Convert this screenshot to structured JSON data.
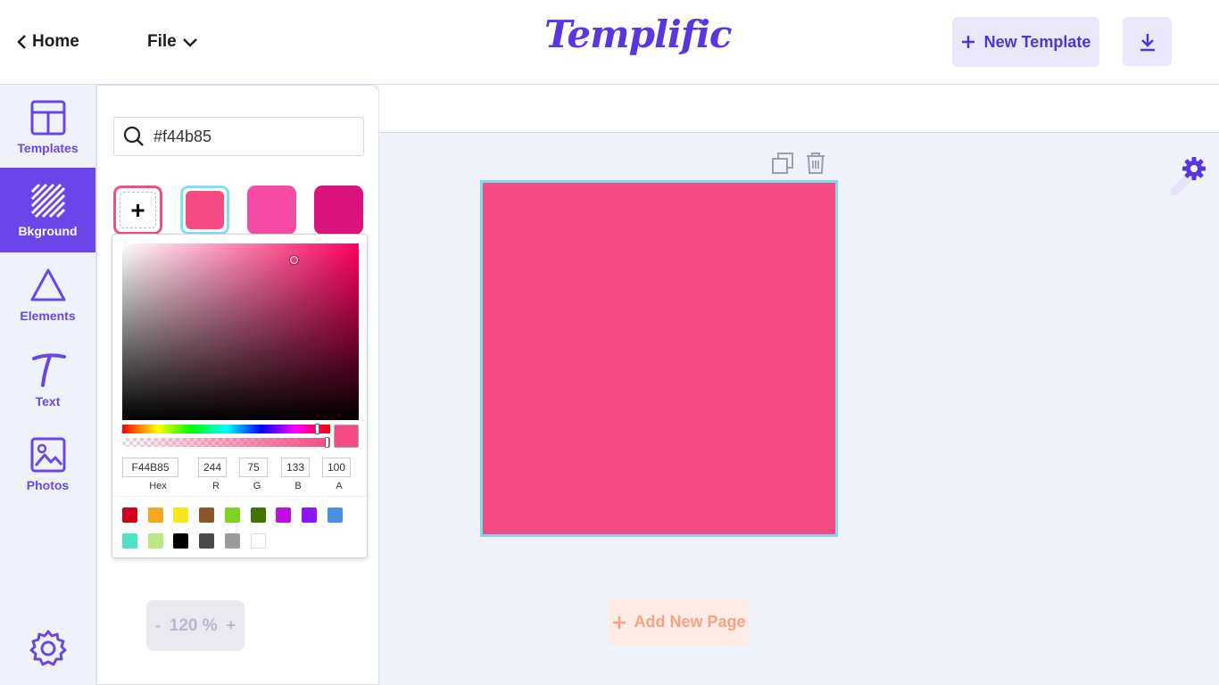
{
  "header": {
    "home_label": "Home",
    "file_label": "File",
    "logo_text": "Templific",
    "new_template_label": "New Template",
    "download_icon": "download-icon"
  },
  "sidebar": {
    "items": [
      {
        "label": "Templates",
        "icon": "layout-icon"
      },
      {
        "label": "Bkground",
        "icon": "background-stripes-icon",
        "active": true
      },
      {
        "label": "Elements",
        "icon": "triangle-icon"
      },
      {
        "label": "Text",
        "icon": "text-t-icon"
      },
      {
        "label": "Photos",
        "icon": "image-icon"
      }
    ],
    "settings_icon": "gear-icon"
  },
  "panel": {
    "search_value": "#f44b85",
    "swatches": [
      "#f44b85",
      "#f44ca5",
      "#db137f"
    ],
    "picker": {
      "hex": "F44B85",
      "r": "244",
      "g": "75",
      "b": "133",
      "a": "100",
      "labels": {
        "hex": "Hex",
        "r": "R",
        "g": "G",
        "b": "B",
        "a": "A"
      },
      "current_color": "#f44b85",
      "presets": [
        "#d0021b",
        "#f5a623",
        "#f8e71c",
        "#8b572a",
        "#7ed321",
        "#417505",
        "#bd10e0",
        "#9013fe",
        "#4a90e2",
        "#50e3c2",
        "#b8e986",
        "#000000",
        "#4a4a4a",
        "#9b9b9b",
        "#ffffff"
      ]
    },
    "zoom": {
      "minus": "-",
      "value": "120 %",
      "plus": "+"
    }
  },
  "canvas": {
    "page_color": "#f44b85",
    "add_page_label": "Add New Page"
  },
  "colors": {
    "accent": "#6b45e8",
    "selection": "#7ed8ee"
  }
}
